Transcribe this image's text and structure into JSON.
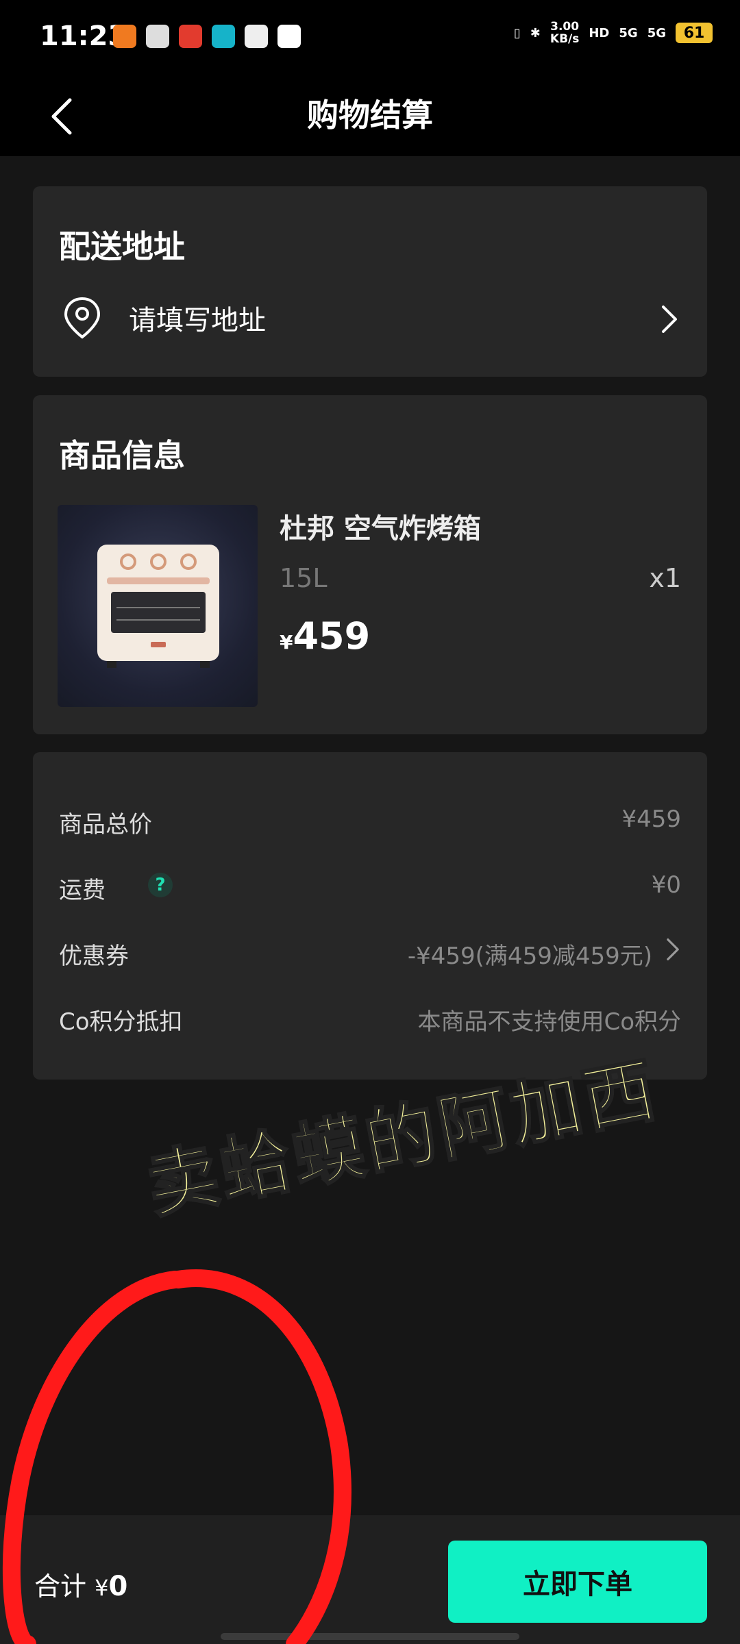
{
  "status_bar": {
    "time": "11:23",
    "net_speed_value": "3.00",
    "net_speed_unit": "KB/s",
    "hd_label": "HD",
    "signal1_label": "5G",
    "signal2_label": "5G",
    "battery": "61"
  },
  "header": {
    "title": "购物结算"
  },
  "address": {
    "title": "配送地址",
    "placeholder": "请填写地址"
  },
  "product": {
    "section_title": "商品信息",
    "name": "杜邦 空气炸烤箱",
    "spec": "15L",
    "quantity": "x1",
    "currency": "¥",
    "price": "459"
  },
  "summary": {
    "rows": [
      {
        "label": "商品总价",
        "value": "¥459"
      },
      {
        "label": "运费",
        "value": "¥0"
      },
      {
        "label": "优惠券",
        "value": "-¥459(满459减459元)"
      },
      {
        "label": "Co积分抵扣",
        "value": "本商品不支持使用Co积分"
      }
    ],
    "help_icon_glyph": "?"
  },
  "overlay": {
    "handwritten_text": "卖蛤蟆的阿加西",
    "circle_color": "#ff1a1a"
  },
  "footer": {
    "total_label": "合计",
    "total_currency": "¥",
    "total_value": "0",
    "order_button": "立即下单"
  },
  "colors": {
    "accent": "#10f0c4",
    "background": "#161616",
    "card": "#272727"
  }
}
